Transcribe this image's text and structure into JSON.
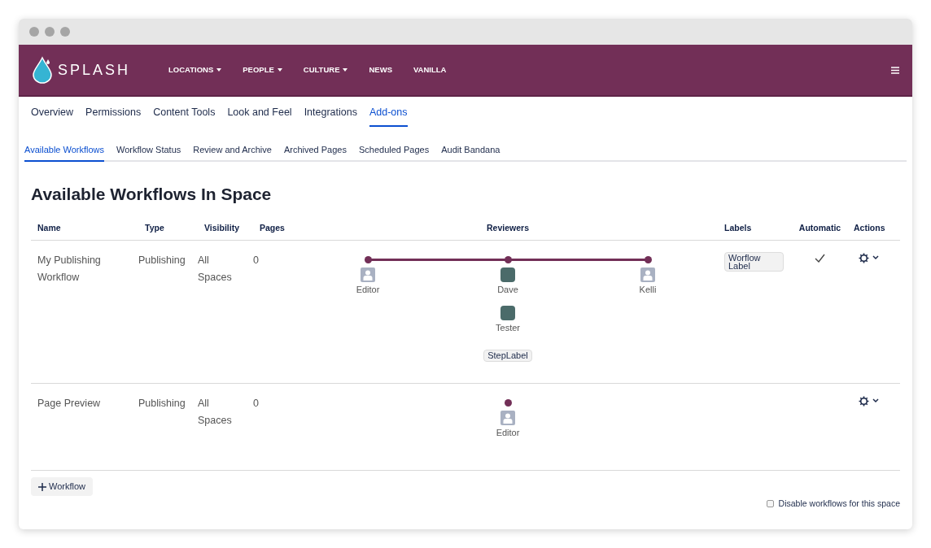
{
  "brand": {
    "name": "SPLASH"
  },
  "nav": [
    {
      "label": "LOCATIONS",
      "dropdown": true
    },
    {
      "label": "PEOPLE",
      "dropdown": true
    },
    {
      "label": "CULTURE",
      "dropdown": true
    },
    {
      "label": "NEWS",
      "dropdown": false
    },
    {
      "label": "VANILLA",
      "dropdown": false
    }
  ],
  "tabs": [
    {
      "label": "Overview",
      "selected": false
    },
    {
      "label": "Permissions",
      "selected": false
    },
    {
      "label": "Content Tools",
      "selected": false
    },
    {
      "label": "Look and Feel",
      "selected": false
    },
    {
      "label": "Integrations",
      "selected": false
    },
    {
      "label": "Add-ons",
      "selected": true
    }
  ],
  "subtabs": [
    {
      "label": "Available Workflows",
      "selected": true
    },
    {
      "label": "Workflow Status",
      "selected": false
    },
    {
      "label": "Review and Archive",
      "selected": false
    },
    {
      "label": "Archived Pages",
      "selected": false
    },
    {
      "label": "Scheduled Pages",
      "selected": false
    },
    {
      "label": "Audit Bandana",
      "selected": false
    }
  ],
  "heading": "Available Workflows In Space",
  "table": {
    "columns": [
      "Name",
      "Type",
      "Visibility",
      "Pages",
      "Reviewers",
      "Labels",
      "Automatic",
      "Actions"
    ],
    "rows": [
      {
        "name": "My Publishing Workflow",
        "type": "Publishing",
        "visibility": "All Spaces",
        "pages": "0",
        "steps": [
          {
            "reviewers": [
              {
                "name": "Editor",
                "kind": "placeholder"
              }
            ]
          },
          {
            "reviewers": [
              {
                "name": "Dave",
                "kind": "photo"
              },
              {
                "name": "Tester",
                "kind": "photo"
              }
            ],
            "label": "StepLabel"
          },
          {
            "reviewers": [
              {
                "name": "Kelli",
                "kind": "placeholder"
              }
            ]
          }
        ],
        "labels": [
          "Worflow Label"
        ],
        "automatic": true
      },
      {
        "name": "Page Preview",
        "type": "Publishing",
        "visibility": "All Spaces",
        "pages": "0",
        "steps": [
          {
            "reviewers": [
              {
                "name": "Editor",
                "kind": "placeholder"
              }
            ]
          }
        ],
        "labels": [],
        "automatic": false
      }
    ]
  },
  "add_button": "Workflow",
  "disable_option": {
    "label": "Disable workflows for this space",
    "checked": false
  }
}
